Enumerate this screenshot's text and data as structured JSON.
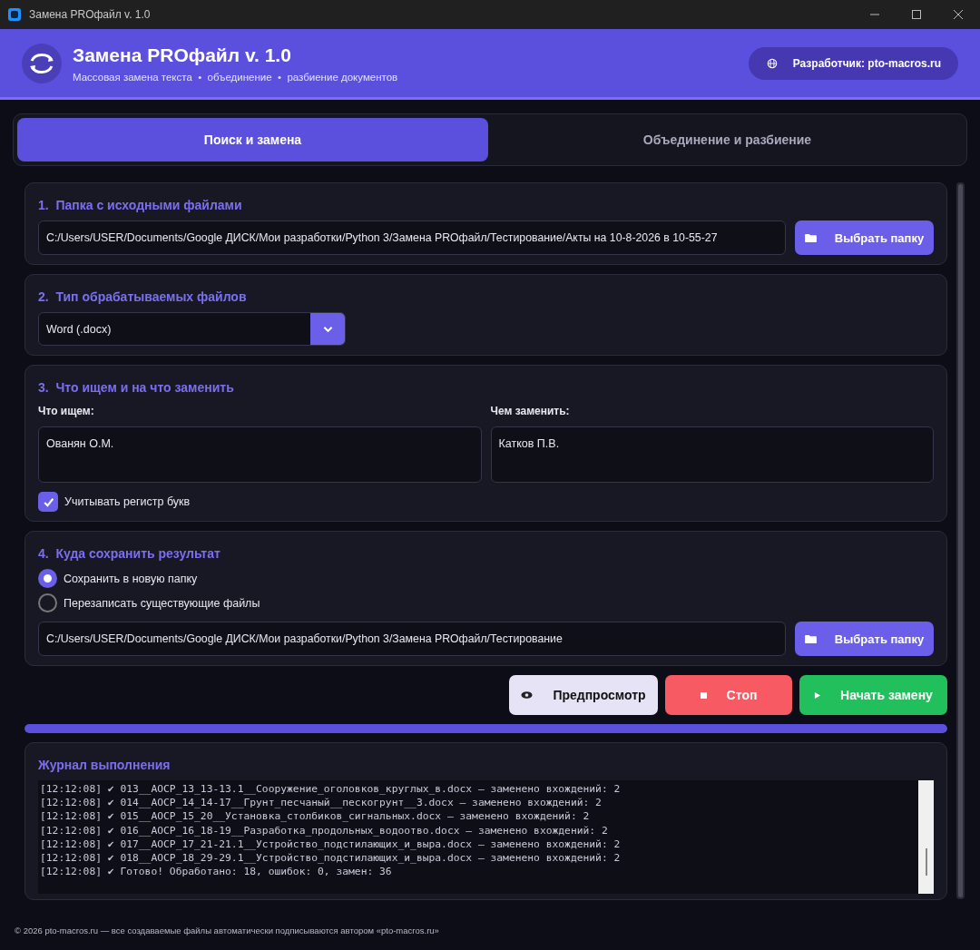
{
  "window": {
    "title": "Замена PROфайл v. 1.0"
  },
  "header": {
    "title": "Замена PROфайл v. 1.0",
    "subtitle": "Массовая замена текста  •  объединение  •  разбиение документов",
    "developer_button": "Разработчик: pto-macros.ru"
  },
  "tabs": [
    {
      "label": "Поиск и замена",
      "selected": true
    },
    {
      "label": "Объединение и разбиение",
      "selected": false
    }
  ],
  "source_folder": {
    "heading": "1.  Папка с исходными файлами",
    "path": "C:/Users/USER/Documents/Google ДИСК/Мои разработки/Python 3/Замена PROфайл/Тестирование/Акты на 10-8-2026 в 10-55-27",
    "button": "Выбрать папку"
  },
  "file_type": {
    "heading": "2.  Тип обрабатываемых файлов",
    "value": "Word (.docx)"
  },
  "search_replace": {
    "heading": "3.  Что ищем и на что заменить",
    "find_label": "Что ищем:",
    "find_value": "Ованян О.М.",
    "replace_label": "Чем заменить:",
    "replace_value": "Катков П.В.",
    "match_case": {
      "label": "Учитывать регистр букв",
      "checked": true
    }
  },
  "output": {
    "heading": "4.  Куда сохранить результат",
    "options": [
      {
        "label": "Сохранить в новую папку",
        "selected": true
      },
      {
        "label": "Перезаписать существующие файлы",
        "selected": false
      }
    ],
    "path": "C:/Users/USER/Documents/Google ДИСК/Мои разработки/Python 3/Замена PROфайл/Тестирование",
    "button": "Выбрать папку"
  },
  "actions": [
    {
      "label": "Предпросмотр",
      "kind": "preview"
    },
    {
      "label": "Стоп",
      "kind": "stop"
    },
    {
      "label": "Начать замену",
      "kind": "start"
    }
  ],
  "progress": {
    "level": 1
  },
  "log": {
    "title": "Журнал выполнения",
    "lines": [
      "[12:12:08] ✔ 013__АОСР_13_13-13.1__Сооружение_оголовков_круглых_в.docx — заменено вхождений: 2",
      "[12:12:08] ✔ 014__АОСР_14_14-17__Грунт_песчаный__пескогрунт__3.docx — заменено вхождений: 2",
      "[12:12:08] ✔ 015__АОСР_15_20__Установка_столбиков_сигнальных.docx — заменено вхождений: 2",
      "[12:12:08] ✔ 016__АОСР_16_18-19__Разработка_продольных_водоотво.docx — заменено вхождений: 2",
      "[12:12:08] ✔ 017__АОСР_17_21-21.1__Устройство_подстилающих_и_выра.docx — заменено вхождений: 2",
      "[12:12:08] ✔ 018__АОСР_18_29-29.1__Устройство_подстилающих_и_выра.docx — заменено вхождений: 2",
      "[12:12:08] ✔ Готово! Обработано: 18, ошибок: 0, замен: 36"
    ]
  },
  "footer": "© 2026 pto-macros.ru — все создаваемые файлы автоматически подписываются автором «pto-macros.ru»"
}
